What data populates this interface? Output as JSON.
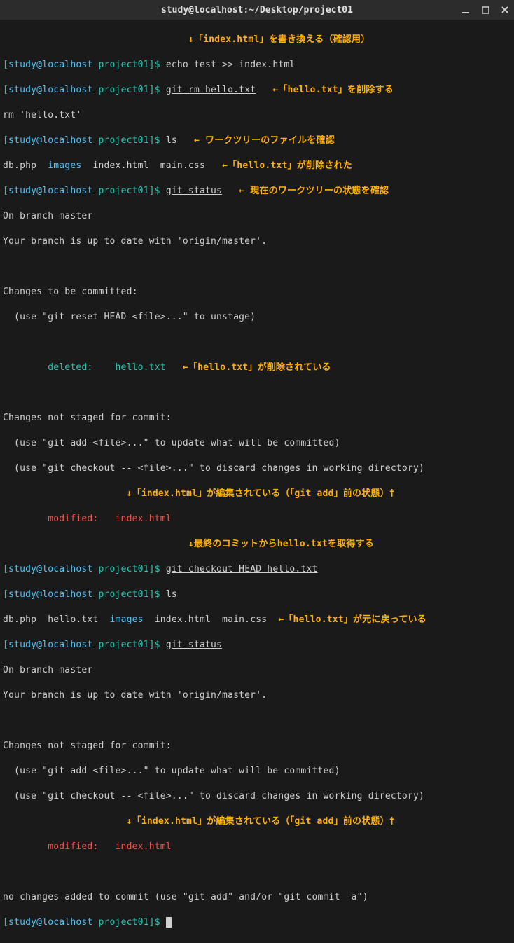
{
  "titlebar": {
    "title": "study@localhost:~/Desktop/project01"
  },
  "prompt": {
    "lbracket": "[",
    "user": "study@localhost",
    "path": " project01",
    "rbracket": "]",
    "dollar": "$ "
  },
  "lines": {
    "a1": "↓「index.html」を書き換える（確認用）",
    "c1": "echo test >> index.html",
    "c2": "g",
    "c2u": "it rm hello.txt",
    "a2": "   ←「hello.txt」を削除する",
    "o1": "rm 'hello.txt'",
    "c3": "ls",
    "a3": "   ← ワークツリーのファイルを確認",
    "o2a": "db.php  ",
    "o2b": "images",
    "o2c": "  index.html  main.css   ",
    "a4": "←「hello.txt」が削除された",
    "c4": "g",
    "c4u": "it status",
    "a5": "   ← 現在のワークツリーの状態を確認",
    "o3": "On branch master",
    "o4": "Your branch is up to date with 'origin/master'.",
    "blank": " ",
    "o5": "Changes to be committed:",
    "o6": "  (use \"git reset HEAD <file>...\" to unstage)",
    "o7": "        deleted:    hello.txt",
    "a6": "   ←「hello.txt」が削除されている",
    "o8": "Changes not staged for commit:",
    "o9": "  (use \"git add <file>...\" to update what will be committed)",
    "o10": "  (use \"git checkout -- <file>...\" to discard changes in working directory)",
    "a7": "↓「index.html」が編集されている（「git add」前の状態）†",
    "o11": "        modified:   index.html",
    "a8": "↓最終のコミットからhello.txtを取得する",
    "c5": "g",
    "c5u": "it checkout HEAD hello.txt",
    "c6": "ls",
    "o12a": "db.php  hello.txt  ",
    "o12b": "images",
    "o12c": "  index.html  main.css  ",
    "a9": "←「hello.txt」が元に戻っている",
    "c7": "g",
    "c7u": "it status",
    "o13": "On branch master",
    "o14": "Your branch is up to date with 'origin/master'.",
    "o15": "Changes not staged for commit:",
    "o16": "  (use \"git add <file>...\" to update what will be committed)",
    "o17": "  (use \"git checkout -- <file>...\" to discard changes in working directory)",
    "a10": "↓「index.html」が編集されている（「git add」前の状態）†",
    "o18": "        modified:   index.html",
    "o19": "no changes added to commit (use \"git add\" and/or \"git commit -a\")"
  }
}
